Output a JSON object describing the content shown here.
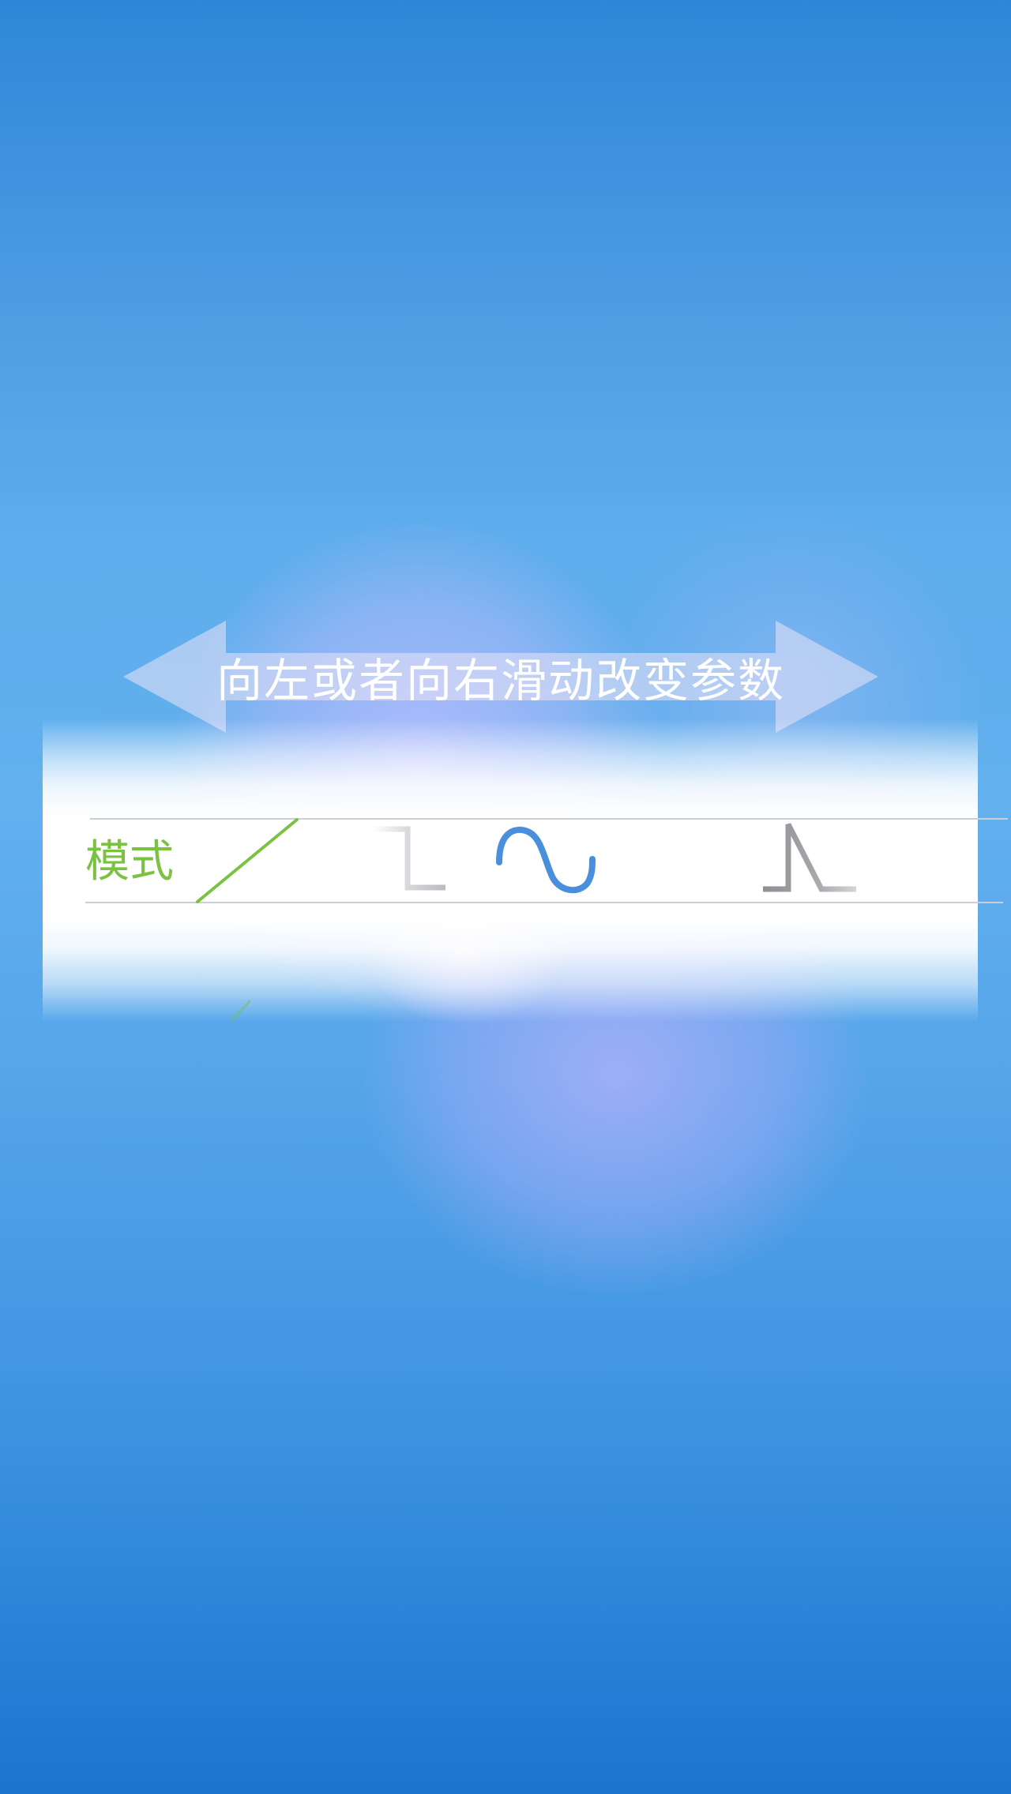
{
  "hint": {
    "text": "向左或者向右滑动改变参数"
  },
  "mode_picker": {
    "label": "模式",
    "options": [
      {
        "icon": "ramp-wave-icon",
        "color": "#7cc242"
      },
      {
        "icon": "step-wave-icon",
        "color": "#c4c6c9"
      },
      {
        "icon": "sine-wave-icon",
        "color": "#4a8fdc"
      },
      {
        "icon": "pulse-wave-icon",
        "color": "#9a9c9f"
      }
    ]
  },
  "colors": {
    "accent_green": "#7cc242",
    "accent_blue": "#4a8fdc",
    "background_blue": "#3d92e0"
  }
}
